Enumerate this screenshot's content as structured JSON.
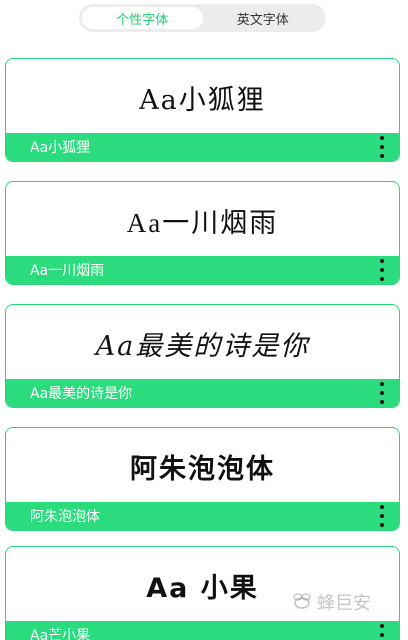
{
  "tabs": [
    {
      "label": "个性字体",
      "active": true
    },
    {
      "label": "英文字体",
      "active": false
    }
  ],
  "fonts": [
    {
      "preview": "Aa小狐狸",
      "name": "Aa小狐狸"
    },
    {
      "preview": "Aa一川烟雨",
      "name": "Aa一川烟雨"
    },
    {
      "preview": "Aa最美的诗是你",
      "name": "Aa最美的诗是你"
    },
    {
      "preview": "阿朱泡泡体",
      "name": "阿朱泡泡体"
    },
    {
      "preview": "Aa 小果",
      "name": "Aa芒小果"
    }
  ],
  "watermark": "蜂巨安",
  "colors": {
    "accent": "#2bdc7e",
    "border": "#2ed37c",
    "tab_active_text": "#22cc73"
  }
}
